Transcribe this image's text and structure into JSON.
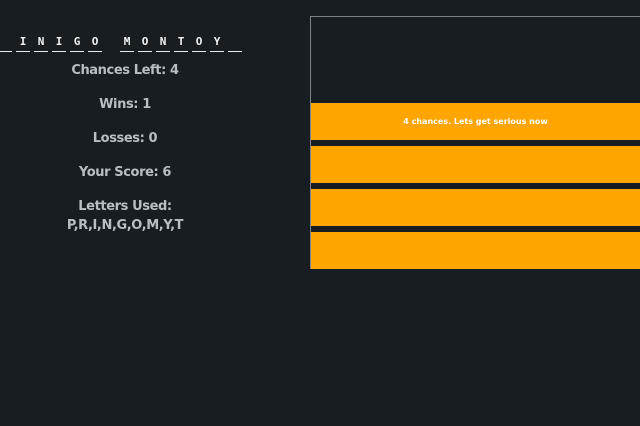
{
  "word": {
    "letters": [
      "I",
      "N",
      "I",
      "G",
      "O",
      "",
      "M",
      "O",
      "N",
      "T",
      "O",
      "Y",
      ""
    ]
  },
  "stats": {
    "chances_left": "Chances Left: 4",
    "wins": "Wins: 1",
    "losses": "Losses: 0",
    "score": "Your Score: 6",
    "letters_used_label": "Letters Used:",
    "letters_used": "P,R,I,N,G,O,M,Y,T"
  },
  "panel": {
    "messages": [
      "4 chances. Lets get serious now",
      "",
      "",
      ""
    ]
  },
  "colors": {
    "background": "#171d21",
    "accent": "#ffa500",
    "text_light": "#b9bec3"
  }
}
